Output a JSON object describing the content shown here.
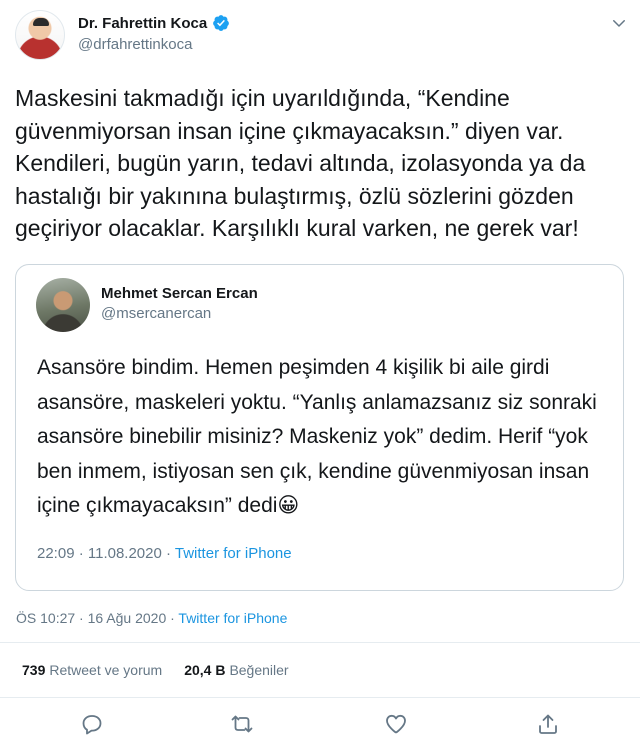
{
  "author": {
    "display_name": "Dr. Fahrettin Koca",
    "handle": "@drfahrettinkoca"
  },
  "tweet": {
    "text": "Maskesini takmadığı için uyarıldığında, “Kendine\ngüvenmiyorsan insan içine çıkmayacaksın.” diyen var.\nKendileri, bugün yarın, tedavi altında, izolasyonda ya da\nhastalığı bir yakınına bulaştırmış, özlü sözlerini gözden\ngeçiriyor olacaklar. Karşılıklı kural varken, ne gerek var!",
    "time": "ÖS 10:27 · 16 Ağu 2020 · ",
    "source": "Twitter for iPhone"
  },
  "quoted": {
    "display_name": "Mehmet Sercan Ercan",
    "handle": "@msercanercan",
    "text": "Asansöre bindim. Hemen peşimden 4 kişilik bi aile girdi\nasansöre, maskeleri yoktu. “Yanlış anlamazsanız siz sonraki\nasansöre binebilir misiniz? Maskeniz yok” dedim. Herif “yok\nben inmem, istiyosan sen çık, kendine güvenmiyosan insan\niçine çıkmayacaksın” dedi😀",
    "time": "22:09 · 11.08.2020 · ",
    "source": "Twitter for iPhone"
  },
  "stats": {
    "retweets_count": "739",
    "retweets_label": "Retweet ve yorum",
    "likes_count": "20,4 B",
    "likes_label": "Beğeniler"
  },
  "icons": {
    "verified": "verified-badge-icon",
    "caret": "chevron-down-icon",
    "reply": "reply-icon",
    "retweet": "retweet-icon",
    "like": "heart-icon",
    "share": "share-icon"
  },
  "colors": {
    "accent": "#1da1f2",
    "link": "#1b95e0",
    "muted": "#657786",
    "text": "#14171a"
  }
}
